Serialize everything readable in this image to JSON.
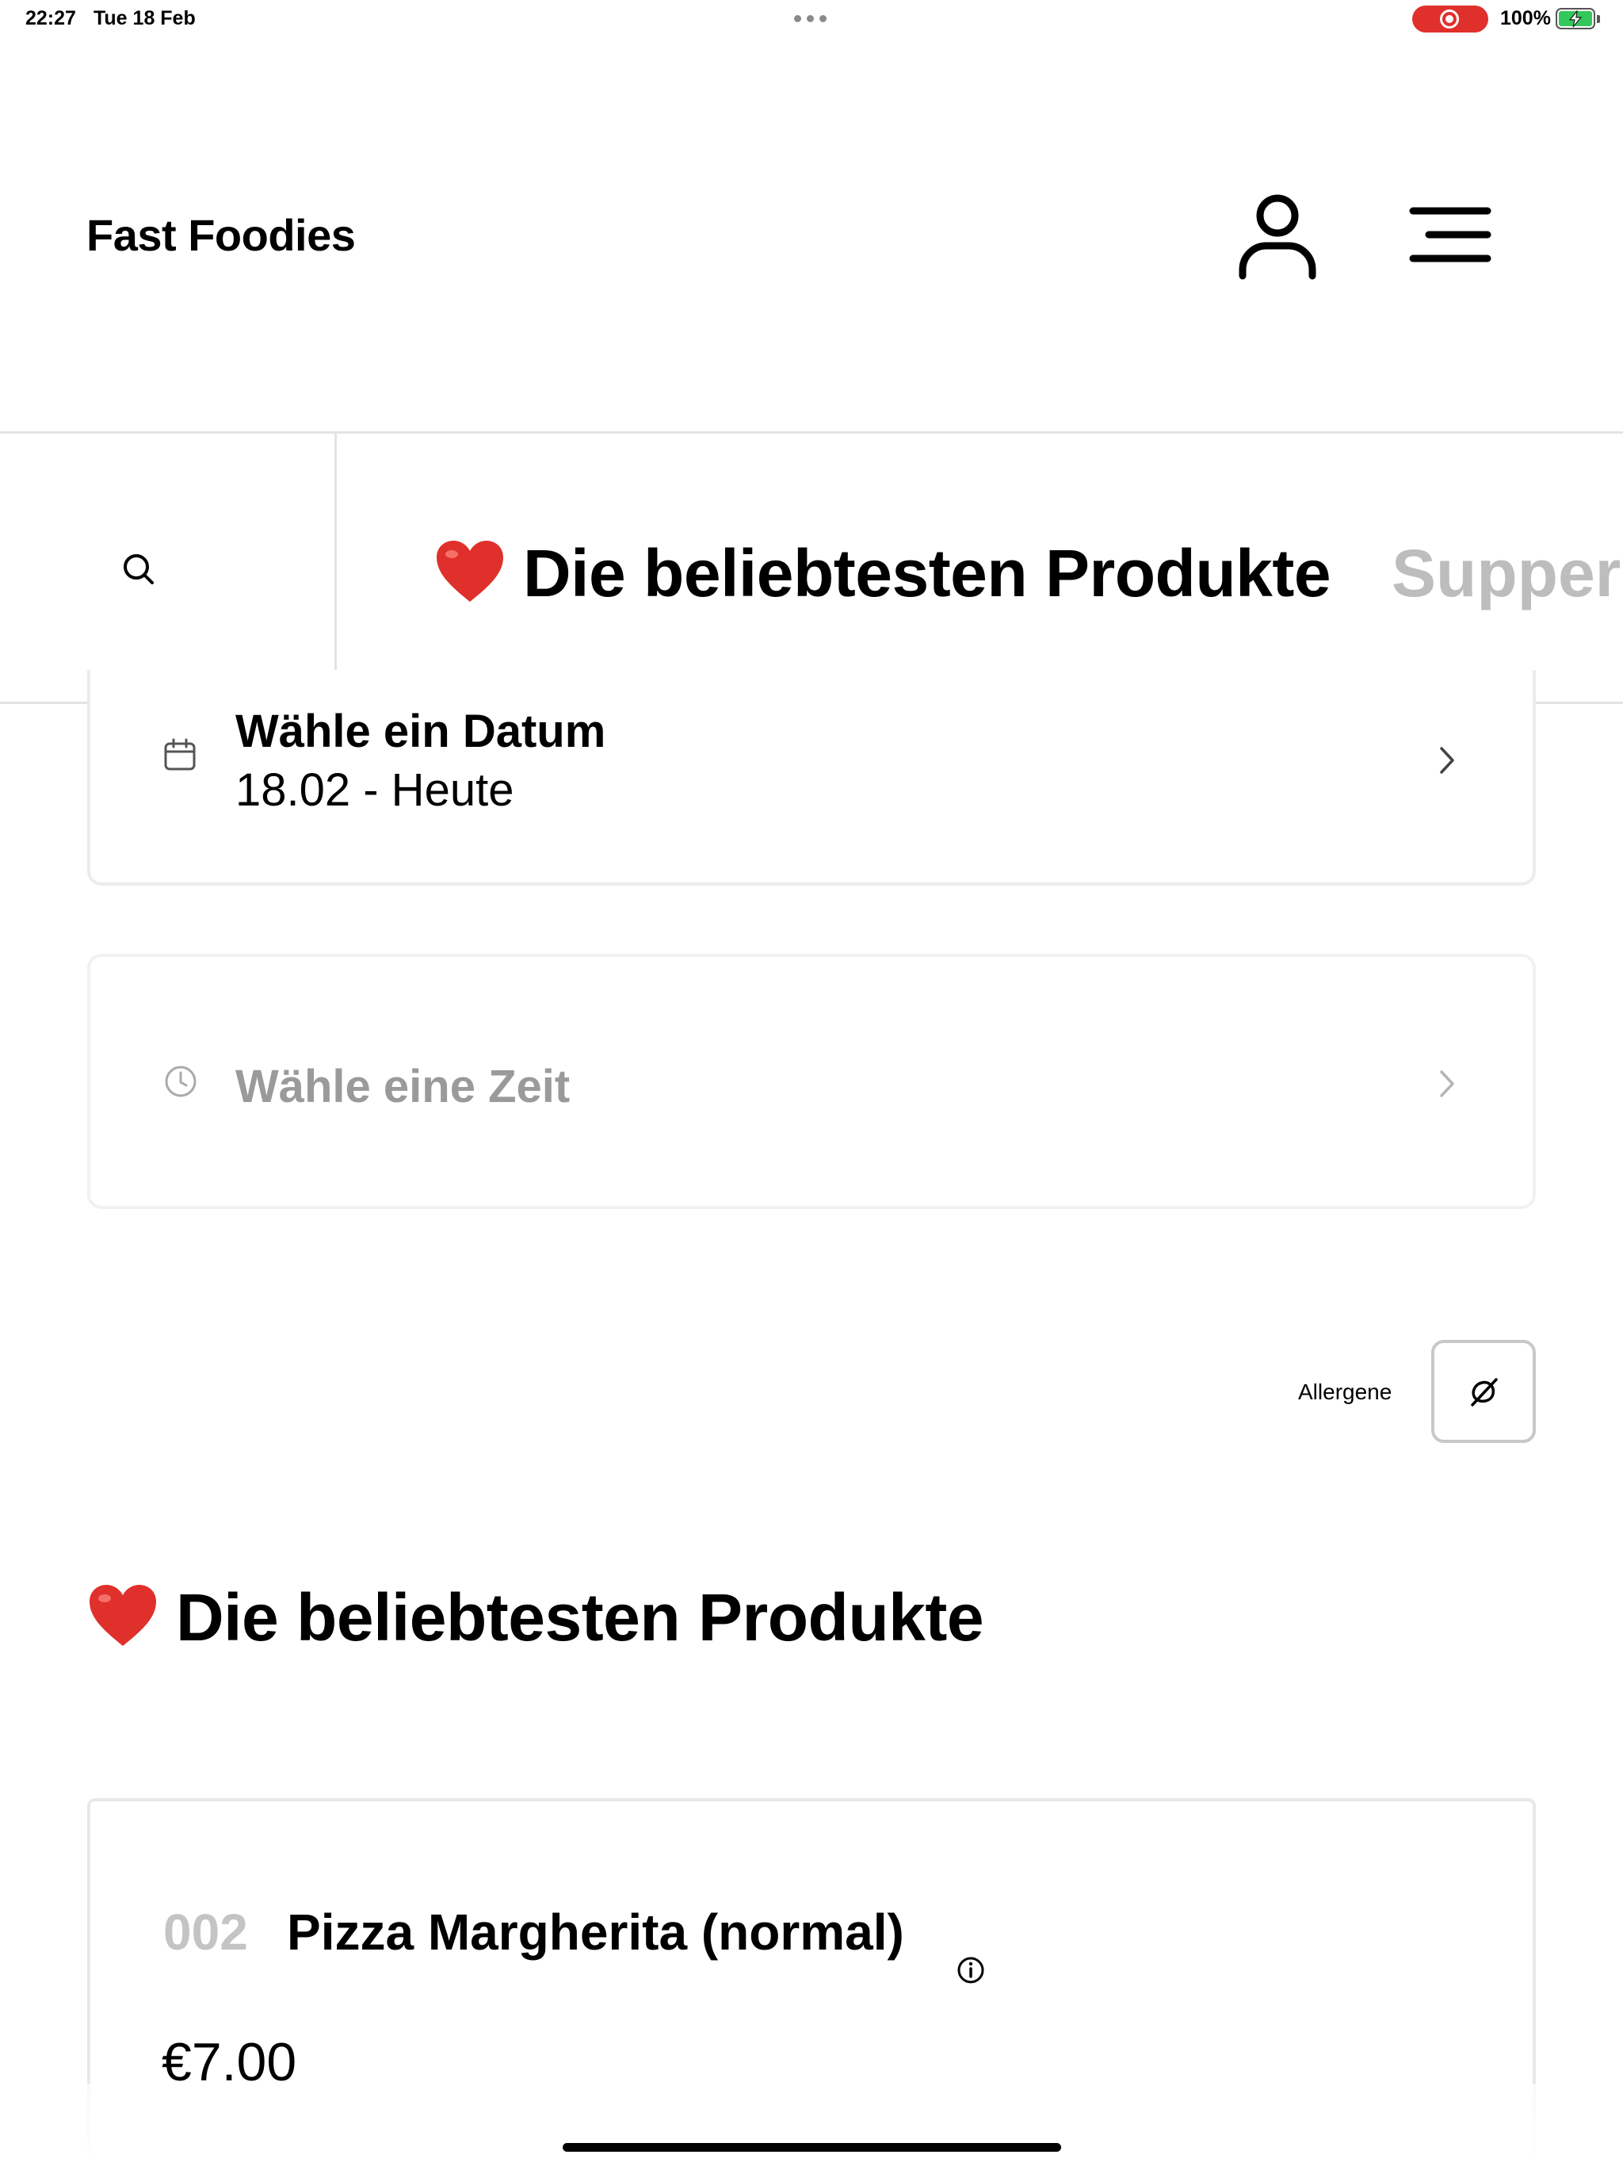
{
  "status_bar": {
    "time": "22:27",
    "date": "Tue 18 Feb",
    "battery": "100%"
  },
  "header": {
    "title": "Fast Foodies",
    "profile_icon": "person-icon",
    "menu_icon": "hamburger-menu-icon"
  },
  "category_bar": {
    "search_icon": "search-icon",
    "active_emoji": "heart-emoji",
    "active_label": "Die beliebtesten Produkte",
    "next_label": "Supper"
  },
  "date_picker": {
    "label": "Wähle ein Datum",
    "value": "18.02 - Heute",
    "icon": "calendar-icon"
  },
  "time_picker": {
    "label": "Wähle eine Zeit",
    "icon": "clock-icon"
  },
  "allergens": {
    "label": "Allergene",
    "icon": "allergen-filter-icon"
  },
  "section": {
    "title": "Die beliebtesten Produkte"
  },
  "products": [
    {
      "number": "002",
      "name": "Pizza Margherita (normal)",
      "price": "€7.00"
    }
  ],
  "colors": {
    "accent_heart": "#e0302b",
    "muted_text": "#9a9a9a",
    "border": "#e3e3e3",
    "battery_green": "#34c759",
    "record_red": "#e0302b"
  }
}
